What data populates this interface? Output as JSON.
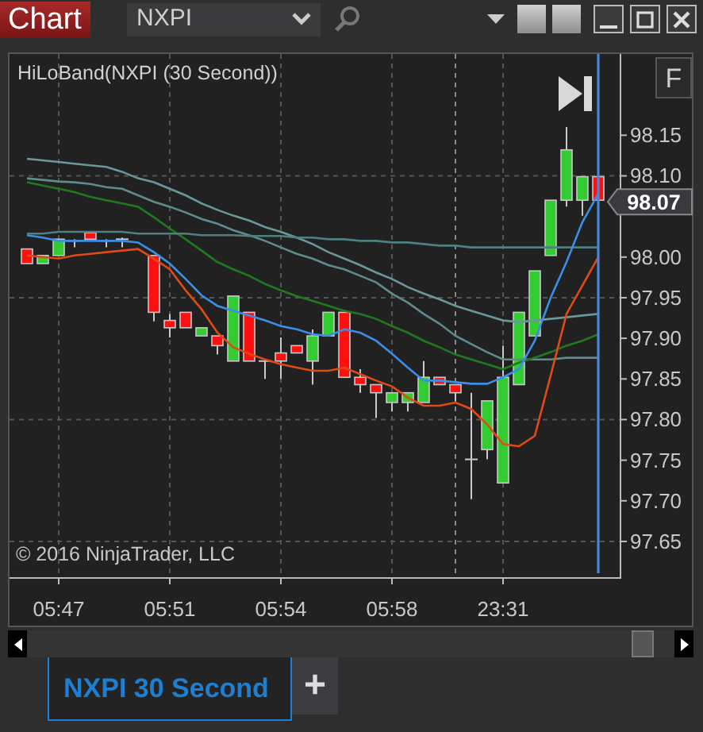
{
  "toolbar": {
    "menu_button": "Chart",
    "instrument": "NXPI"
  },
  "chart": {
    "title": "HiLoBand(NXPI (30 Second))",
    "button": "F",
    "price_marker": "98.07",
    "copyright": "© 2016 NinjaTrader, LLC",
    "chart_data": {
      "type": "candlestick",
      "grid": true,
      "ylim": [
        97.605,
        98.25
      ],
      "categories": [
        null,
        null,
        "05:47",
        null,
        null,
        null,
        null,
        null,
        null,
        "05:51",
        null,
        null,
        null,
        null,
        null,
        null,
        "05:54",
        null,
        null,
        null,
        null,
        null,
        null,
        "05:58",
        null,
        null,
        null,
        null,
        null,
        null,
        "23:31",
        null,
        null,
        null,
        null,
        null,
        null
      ],
      "yticks": [
        {
          "value": 97.65,
          "label": "97.65"
        },
        {
          "value": 97.7,
          "label": "97.70"
        },
        {
          "value": 97.75,
          "label": "97.75"
        },
        {
          "value": 97.8,
          "label": "97.80"
        },
        {
          "value": 97.85,
          "label": "97.85"
        },
        {
          "value": 97.9,
          "label": "97.90"
        },
        {
          "value": 97.95,
          "label": "97.95"
        },
        {
          "value": 98.0,
          "label": "98.00"
        },
        {
          "value": 98.1,
          "label": "98.10"
        },
        {
          "value": 98.15,
          "label": "98.15"
        }
      ],
      "ohlc": [
        [
          98.01,
          98.01,
          97.992,
          97.992
        ],
        [
          97.992,
          98.002,
          97.992,
          98.002
        ],
        [
          98.002,
          98.022,
          98.002,
          98.022
        ],
        [
          98.02,
          98.022,
          98.012,
          98.02
        ],
        [
          98.03,
          98.03,
          98.022,
          98.022
        ],
        [
          98.02,
          98.022,
          98.012,
          98.02
        ],
        [
          98.022,
          98.024,
          98.012,
          98.022
        ],
        null,
        [
          98.002,
          98.002,
          97.921,
          97.932
        ],
        [
          97.922,
          97.93,
          97.901,
          97.913
        ],
        [
          97.932,
          97.932,
          97.913,
          97.913
        ],
        [
          97.903,
          97.913,
          97.903,
          97.913
        ],
        [
          97.903,
          97.903,
          97.88,
          97.891
        ],
        [
          97.872,
          97.952,
          97.872,
          97.952
        ],
        [
          97.932,
          97.932,
          97.872,
          97.872
        ],
        [
          97.872,
          97.872,
          97.85,
          97.872
        ],
        [
          97.882,
          97.901,
          97.85,
          97.872
        ],
        [
          97.891,
          97.891,
          97.882,
          97.882
        ],
        [
          97.872,
          97.911,
          97.843,
          97.903
        ],
        [
          97.903,
          97.932,
          97.903,
          97.932
        ],
        [
          97.932,
          97.932,
          97.852,
          97.852
        ],
        [
          97.852,
          97.862,
          97.833,
          97.843
        ],
        [
          97.843,
          97.843,
          97.802,
          97.833
        ],
        [
          97.821,
          97.833,
          97.81,
          97.833
        ],
        [
          97.821,
          97.833,
          97.81,
          97.833
        ],
        [
          97.821,
          97.872,
          97.821,
          97.852
        ],
        [
          97.852,
          97.852,
          97.843,
          97.843
        ],
        [
          97.843,
          97.843,
          97.823,
          97.833
        ],
        [
          97.751,
          97.833,
          97.702,
          97.751
        ],
        [
          97.763,
          97.823,
          97.751,
          97.823
        ],
        [
          97.722,
          97.891,
          97.722,
          97.852
        ],
        [
          97.843,
          97.932,
          97.843,
          97.932
        ],
        [
          97.903,
          97.983,
          97.903,
          97.983
        ],
        [
          98.002,
          98.07,
          98.002,
          98.07
        ],
        [
          98.07,
          98.16,
          98.062,
          98.132
        ],
        [
          98.07,
          98.099,
          98.051,
          98.099
        ],
        [
          98.099,
          98.099,
          98.068,
          98.07
        ]
      ],
      "series": [
        {
          "type": "line",
          "color": "#6a9898",
          "values": [
            98.121,
            98.119,
            98.117,
            98.115,
            98.113,
            98.111,
            98.105,
            98.097,
            98.092,
            98.084,
            98.076,
            98.066,
            98.058,
            98.051,
            98.045,
            98.037,
            98.031,
            98.024,
            98.016,
            98.006,
            97.998,
            97.99,
            97.981,
            97.973,
            97.963,
            97.955,
            97.948,
            97.94,
            97.934,
            97.928,
            97.922,
            97.92,
            97.922,
            97.924,
            97.926,
            97.928,
            97.93
          ]
        },
        {
          "type": "line",
          "color": "#5e8c8c",
          "values": [
            98.097,
            98.095,
            98.093,
            98.092,
            98.09,
            98.086,
            98.084,
            98.076,
            98.068,
            98.062,
            98.055,
            98.047,
            98.041,
            98.033,
            98.027,
            98.02,
            98.012,
            98.004,
            97.998,
            97.99,
            97.985,
            97.977,
            97.969,
            97.955,
            97.944,
            97.93,
            97.918,
            97.903,
            97.893,
            97.883,
            97.874,
            97.874,
            97.874,
            97.874,
            97.876,
            97.876,
            97.876
          ]
        },
        {
          "type": "line",
          "color": "#1f7a1f",
          "values": [
            98.092,
            98.088,
            98.084,
            98.08,
            98.074,
            98.07,
            98.066,
            98.062,
            98.049,
            98.035,
            98.022,
            98.008,
            97.994,
            97.985,
            97.977,
            97.967,
            97.959,
            97.952,
            97.946,
            97.94,
            97.934,
            97.93,
            97.924,
            97.915,
            97.907,
            97.897,
            97.889,
            97.88,
            97.874,
            97.868,
            97.862,
            97.87,
            97.876,
            97.883,
            97.891,
            97.897,
            97.905
          ]
        },
        {
          "type": "line",
          "color": "#4f7f7f",
          "values": [
            98.029,
            98.029,
            98.031,
            98.031,
            98.031,
            98.031,
            98.031,
            98.029,
            98.029,
            98.029,
            98.029,
            98.027,
            98.027,
            98.027,
            98.026,
            98.026,
            98.026,
            98.024,
            98.024,
            98.022,
            98.022,
            98.02,
            98.02,
            98.018,
            98.018,
            98.016,
            98.014,
            98.014,
            98.012,
            98.012,
            98.012,
            98.012,
            98.012,
            98.012,
            98.012,
            98.012,
            98.012
          ]
        },
        {
          "type": "line",
          "color": "#3a8ee6",
          "values": [
            98.027,
            98.024,
            98.02,
            98.02,
            98.02,
            98.02,
            98.02,
            98.018,
            98.006,
            97.992,
            97.973,
            97.953,
            97.94,
            97.934,
            97.928,
            97.922,
            97.915,
            97.911,
            97.905,
            97.903,
            97.911,
            97.907,
            97.897,
            97.881,
            97.864,
            97.848,
            97.848,
            97.846,
            97.844,
            97.844,
            97.852,
            97.862,
            97.897,
            97.95,
            97.994,
            98.043,
            98.078
          ]
        },
        {
          "type": "line",
          "color": "#e04a16",
          "values": [
            98.002,
            98.0,
            97.998,
            98.002,
            98.004,
            98.006,
            98.008,
            98.01,
            97.998,
            97.985,
            97.959,
            97.936,
            97.907,
            97.889,
            97.881,
            97.874,
            97.868,
            97.864,
            97.86,
            97.86,
            97.864,
            97.856,
            97.848,
            97.841,
            97.827,
            97.817,
            97.817,
            97.821,
            97.813,
            97.794,
            97.77,
            97.767,
            97.78,
            97.854,
            97.93,
            97.965,
            98.0
          ]
        }
      ]
    }
  },
  "tabs": [
    {
      "label": "NXPI 30 Second",
      "selected": true
    }
  ],
  "add_tab": "+"
}
